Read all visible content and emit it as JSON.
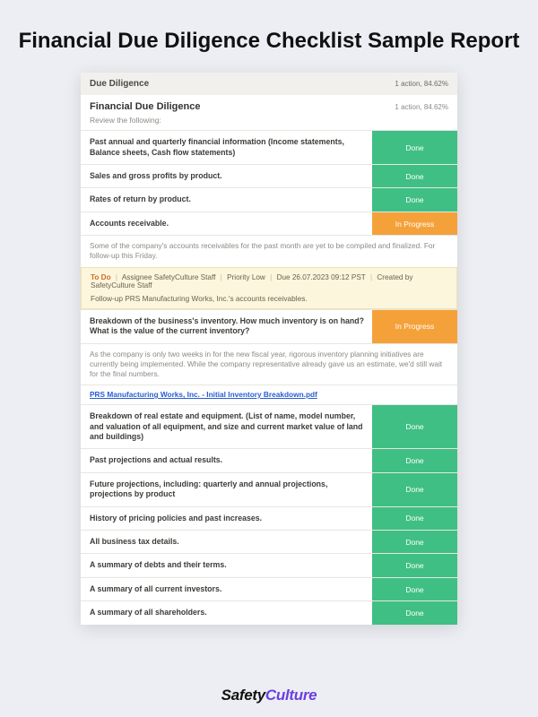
{
  "page_title": "Financial Due Diligence Checklist Sample Report",
  "section": {
    "title": "Due Diligence",
    "meta": "1 action, 84.62%"
  },
  "sub": {
    "title": "Financial Due Diligence",
    "meta": "1 action, 84.62%"
  },
  "review_label": "Review the following:",
  "items": [
    {
      "label": "Past annual and quarterly financial information (Income statements, Balance sheets, Cash flow statements)",
      "status": "Done"
    },
    {
      "label": "Sales and gross profits by product.",
      "status": "Done"
    },
    {
      "label": "Rates of return by product.",
      "status": "Done"
    },
    {
      "label": "Accounts receivable.",
      "status": "In Progress"
    }
  ],
  "ar_note": "Some of the company's accounts receivables for the past month are yet to be compiled and finalized. For follow-up this Friday.",
  "action": {
    "todo": "To Do",
    "assignee_label": "Assignee SafetyCulture Staff",
    "priority": "Priority Low",
    "due": "Due 26.07.2023 09:12 PST",
    "created": "Created by SafetyCulture Staff",
    "followup": "Follow-up PRS Manufacturing Works, Inc.'s accounts receivables."
  },
  "inventory": {
    "label": "Breakdown of the business's inventory. How much inventory is on hand? What is the value of the current inventory?",
    "status": "In Progress",
    "note": "As the company is only two weeks in for the new fiscal year, rigorous inventory planning initiatives are currently being implemented. While the company representative already gave us an estimate, we'd still wait for the final numbers.",
    "link": "PRS Manufacturing Works, Inc. - Initial Inventory Breakdown.pdf"
  },
  "items2": [
    {
      "label": "Breakdown of real estate and equipment. (List of name, model number, and valuation of all equipment, and size and current market value of land and buildings)",
      "status": "Done"
    },
    {
      "label": "Past projections and actual results.",
      "status": "Done"
    },
    {
      "label": "Future projections, including: quarterly and annual projections, projections by product",
      "status": "Done"
    },
    {
      "label": "History of pricing policies and past increases.",
      "status": "Done"
    },
    {
      "label": "All business tax details.",
      "status": "Done"
    },
    {
      "label": "A summary of debts and their terms.",
      "status": "Done"
    },
    {
      "label": "A summary of all current investors.",
      "status": "Done"
    },
    {
      "label": "A summary of all shareholders.",
      "status": "Done"
    }
  ],
  "brand": {
    "safety": "Safety",
    "culture": "Culture"
  }
}
